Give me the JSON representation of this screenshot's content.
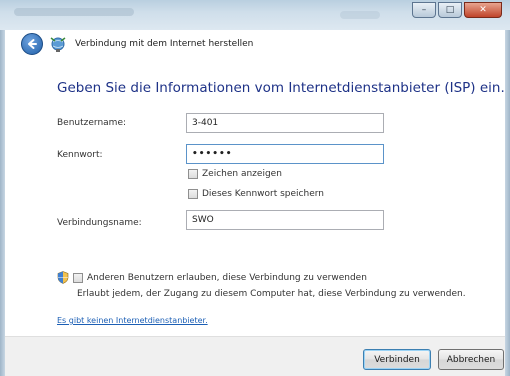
{
  "window": {
    "minimize_glyph": "–",
    "maximize_glyph": "□",
    "close_glyph": "✕"
  },
  "header": {
    "title": "Verbindung mit dem Internet herstellen",
    "back_icon": "back-arrow-icon",
    "app_icon": "network-globe-icon"
  },
  "main": {
    "instruction": "Geben Sie die Informationen vom Internetdienstanbieter (ISP) ein.",
    "username_label": "Benutzername:",
    "username_value": "3-401",
    "password_label": "Kennwort:",
    "password_value": "••••••",
    "show_chars_label": "Zeichen anzeigen",
    "remember_password_label": "Dieses Kennwort speichern",
    "connection_name_label": "Verbindungsname:",
    "connection_name_value": "SWO",
    "allow_others_label": "Anderen Benutzern erlauben, diese Verbindung zu verwenden",
    "allow_others_desc": "Erlaubt jedem, der Zugang zu diesem Computer hat, diese Verbindung zu verwenden.",
    "no_isp_link": "Es gibt keinen Internetdienstanbieter."
  },
  "footer": {
    "connect_label": "Verbinden",
    "cancel_label": "Abbrechen"
  },
  "colors": {
    "instruction": "#1e3287",
    "link": "#1c5fb5",
    "focus_border": "#5b93c9"
  }
}
